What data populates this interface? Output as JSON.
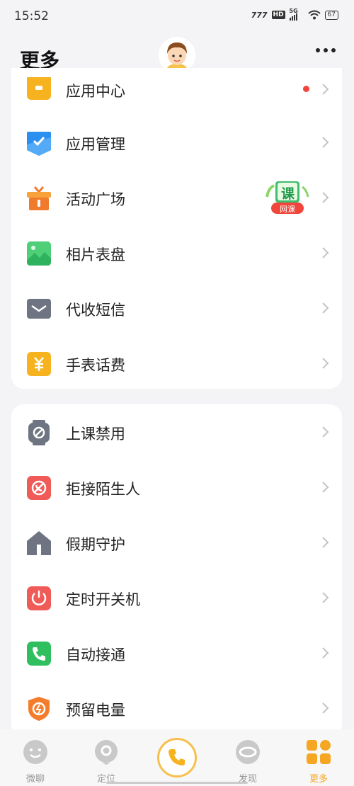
{
  "status": {
    "time": "15:52",
    "net": "777",
    "hd": "HD",
    "gen": "5G",
    "battery": "67"
  },
  "header": {
    "title": "更多"
  },
  "card1": {
    "items": [
      {
        "label": "应用中心"
      },
      {
        "label": "应用管理"
      },
      {
        "label": "活动广场"
      },
      {
        "label": "相片表盘"
      },
      {
        "label": "代收短信"
      },
      {
        "label": "手表话费"
      }
    ],
    "badge": {
      "char": "课",
      "text": "网课"
    }
  },
  "card2": {
    "items": [
      {
        "label": "上课禁用"
      },
      {
        "label": "拒接陌生人"
      },
      {
        "label": "假期守护"
      },
      {
        "label": "定时开关机"
      },
      {
        "label": "自动接通"
      },
      {
        "label": "预留电量"
      }
    ]
  },
  "nav": {
    "items": [
      {
        "label": "微聊"
      },
      {
        "label": "定位"
      },
      {
        "label": "发现"
      },
      {
        "label": "更多"
      }
    ],
    "active_color": "#f5a623"
  }
}
